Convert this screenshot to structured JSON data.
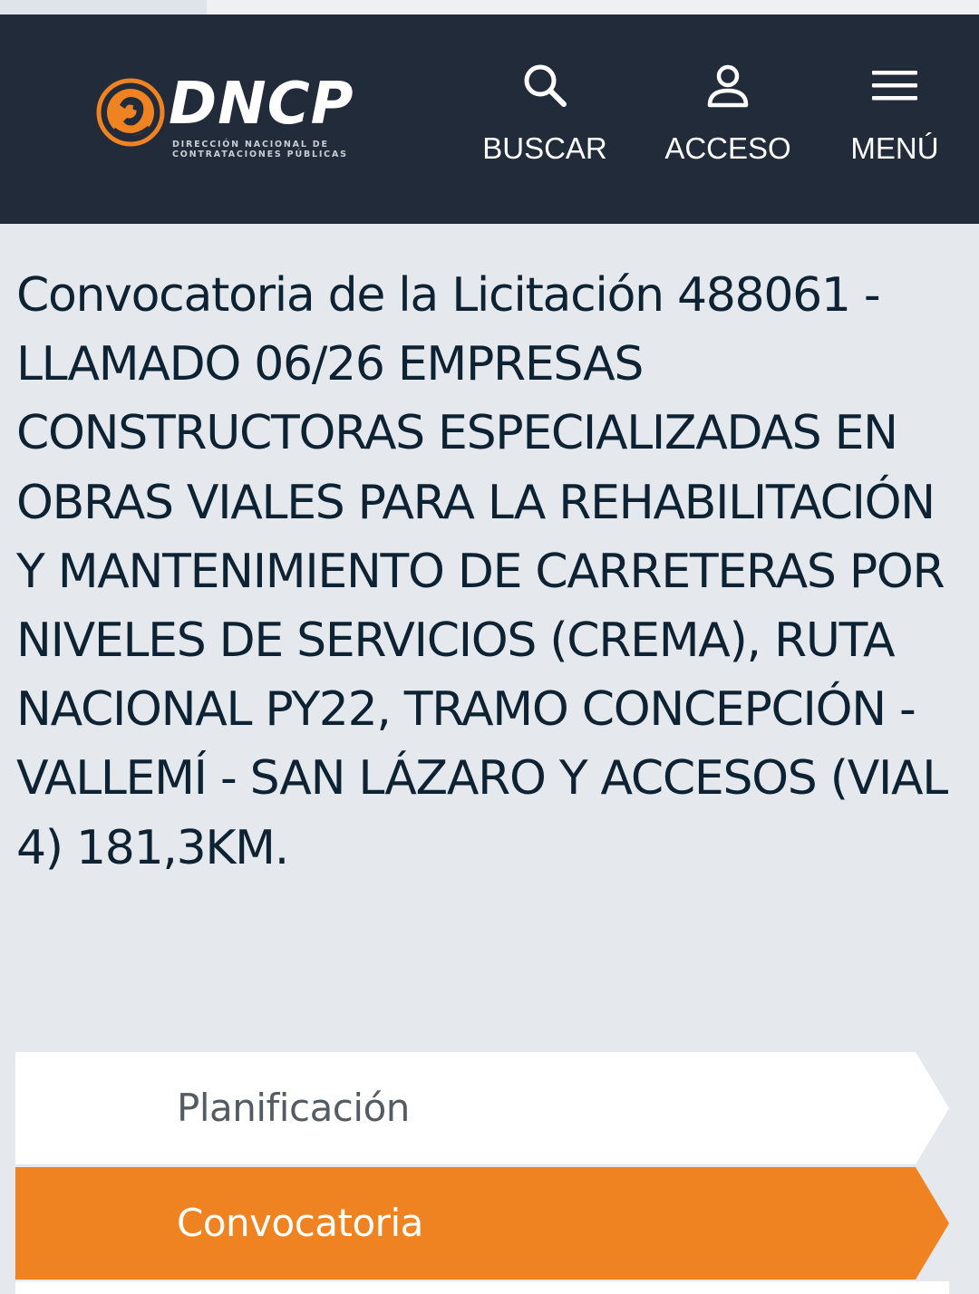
{
  "header": {
    "logo": {
      "wordmark": "DNCP",
      "subtitle_line1": "DIRECCIÓN NACIONAL DE",
      "subtitle_line2": "CONTRATACIONES PÚBLICAS",
      "colors": {
        "accent": "#f08321",
        "text": "#ffffff"
      }
    },
    "nav": {
      "search_label": "BUSCAR",
      "search_icon": "search-icon",
      "access_label": "ACCESO",
      "access_icon": "user-icon",
      "menu_label": "MENÚ",
      "menu_icon": "hamburger-icon"
    },
    "background": "#212b39"
  },
  "main": {
    "title": "Convocatoria de la Licitación 488061 - LLAMADO 06/26 EMPRESAS CONSTRUCTORAS ESPECIALIZADAS EN OBRAS VIALES PARA LA REHABILITACIÓN Y MANTENIMIENTO DE CARRETERAS POR NIVELES DE SERVICIOS (CREMA), RUTA NACIONAL PY22, TRAMO CONCEPCIÓN - VALLEMÍ - SAN LÁZARO Y ACCESOS (VIAL 4) 181,3KM.",
    "steps": [
      {
        "label": "Planificación",
        "active": false,
        "color": "#ffffff"
      },
      {
        "label": "Convocatoria",
        "active": true,
        "color": "#f08321"
      }
    ]
  }
}
